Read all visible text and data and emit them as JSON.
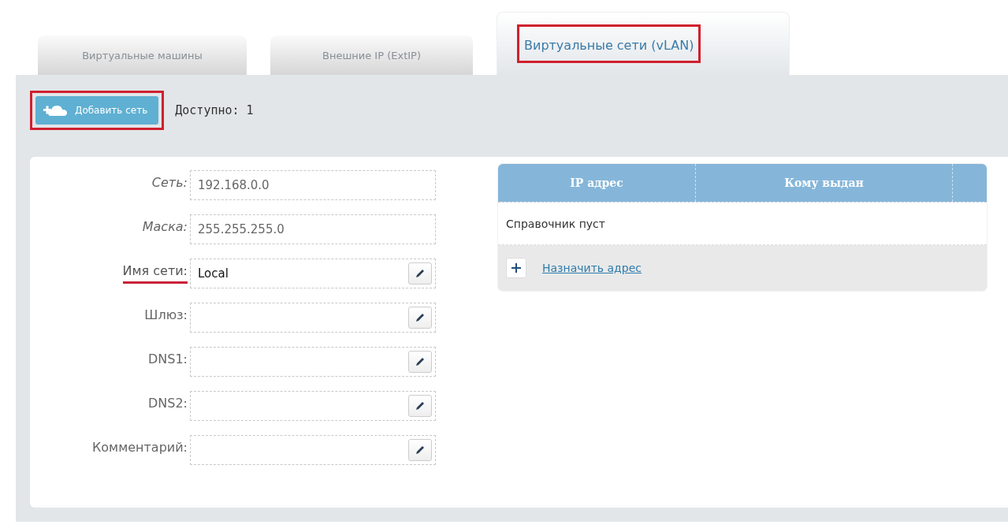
{
  "tabs": [
    {
      "label": "Виртуальные машины",
      "selected": false,
      "highlighted": false
    },
    {
      "label": "Внешние IP (ExtIP)",
      "selected": false,
      "highlighted": false
    },
    {
      "label": "Виртуальные сети (vLAN)",
      "selected": true,
      "highlighted": true
    }
  ],
  "toolbar": {
    "add_button": {
      "label": "Добавить сеть",
      "highlighted": true
    },
    "available": "Доступно: 1"
  },
  "form": [
    {
      "label": "Сеть:",
      "value": "192.168.0.0",
      "kind": "readonly",
      "highlighted": false
    },
    {
      "label": "Маска:",
      "value": "255.255.255.0",
      "kind": "readonly",
      "highlighted": false
    },
    {
      "label": "Имя сети:",
      "value": "Local",
      "kind": "editable",
      "highlighted": true
    },
    {
      "label": "Шлюз:",
      "kind": "editable",
      "highlighted": false
    },
    {
      "label": "DNS1:",
      "kind": "editable",
      "highlighted": false
    },
    {
      "label": "DNS2:",
      "kind": "editable",
      "highlighted": false
    },
    {
      "label": "Комментарий:",
      "kind": "editable",
      "highlighted": false
    }
  ],
  "table": {
    "columns": [
      "IP адрес",
      "Кому выдан"
    ],
    "empty_text": "Справочник пуст",
    "add_link": "Назначить адрес"
  }
}
